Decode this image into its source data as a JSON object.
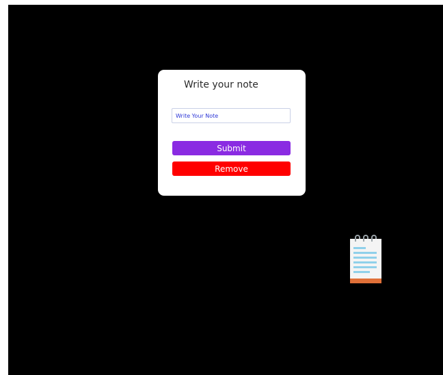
{
  "card": {
    "title": "Write your note",
    "input": {
      "placeholder": "Write Your Note",
      "value": ""
    },
    "submit_label": "Submit",
    "remove_label": "Remove"
  },
  "colors": {
    "background": "#000000",
    "card": "#ffffff",
    "submit": "#8a2be2",
    "remove": "#ff0000"
  },
  "icons": {
    "notepad": "notepad-icon"
  }
}
